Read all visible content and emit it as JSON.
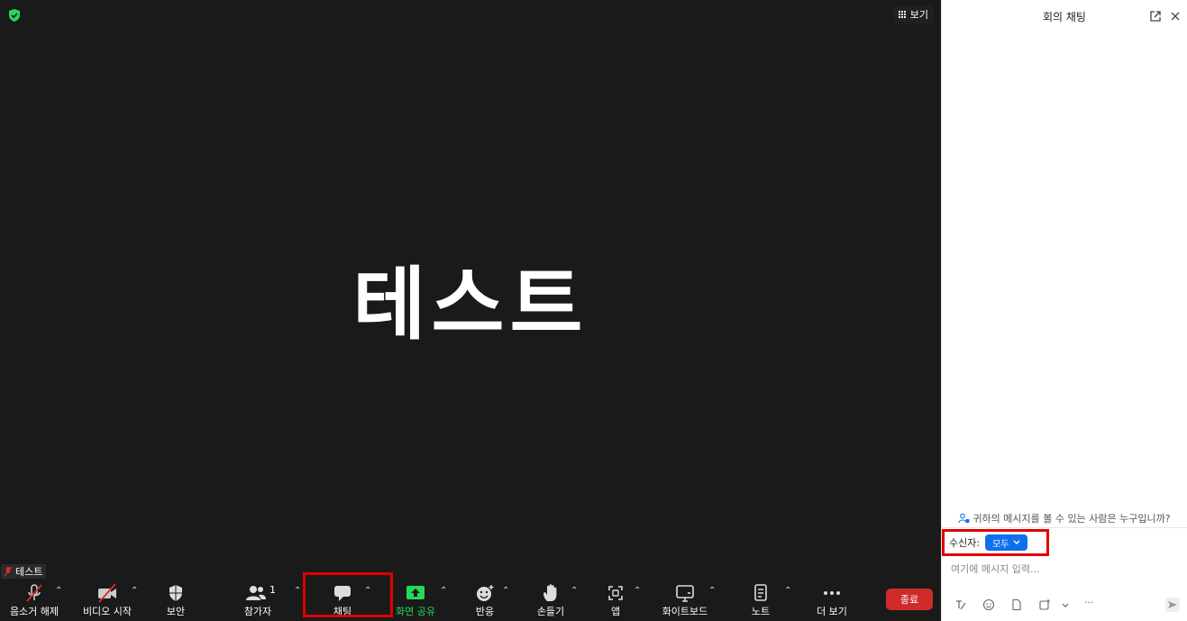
{
  "meeting": {
    "participant_display_name": "테스트",
    "name_tag": "테스트",
    "view_label": "보기"
  },
  "toolbar": {
    "unmute_label": "음소거 해제",
    "video_label": "비디오 시작",
    "security_label": "보안",
    "participants_label": "참가자",
    "participants_count": "1",
    "chat_label": "채팅",
    "share_label": "화면 공유",
    "reactions_label": "반응",
    "raise_hand_label": "손들기",
    "apps_label": "앱",
    "whiteboard_label": "화이트보드",
    "notes_label": "노트",
    "more_label": "더 보기",
    "end_label": "종료"
  },
  "chat": {
    "title": "회의 채팅",
    "who_can_see": "귀하의 메시지를 볼 수 있는 사람은 누구입니까?",
    "recipient_label": "수신자:",
    "recipient_value": "모두",
    "input_placeholder": "여기에 메시지 입력...",
    "more_tools": "···"
  },
  "colors": {
    "meeting_bg": "#1a1a1a",
    "share_green": "#23d959",
    "end_red": "#d02b2b",
    "accent_blue": "#0e71eb",
    "highlight_red": "#e00000"
  }
}
